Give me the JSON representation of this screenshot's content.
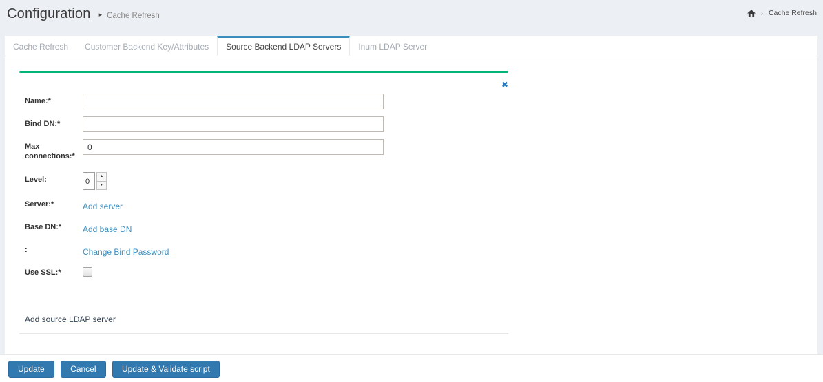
{
  "header": {
    "title": "Configuration",
    "separator_glyph": "▸",
    "section": "Cache Refresh",
    "breadcrumb": {
      "separator": "›",
      "current": "Cache Refresh"
    }
  },
  "tabs": {
    "items": [
      {
        "label": "Cache Refresh"
      },
      {
        "label": "Customer Backend Key/Attributes"
      },
      {
        "label": "Source Backend LDAP Servers"
      },
      {
        "label": "Inum LDAP Server"
      }
    ],
    "active_label": "Source Backend LDAP Servers"
  },
  "form": {
    "close_glyph": "✖",
    "name": {
      "label": "Name:*",
      "value": ""
    },
    "bind_dn": {
      "label": "Bind DN:*",
      "value": ""
    },
    "max_connections": {
      "label": "Max connections:*",
      "value": "0"
    },
    "level": {
      "label": "Level:",
      "value": "0",
      "up_glyph": "▴",
      "down_glyph": "▾"
    },
    "server": {
      "label": "Server:*",
      "link": "Add server"
    },
    "base_dn": {
      "label": "Base DN:*",
      "link": "Add base DN"
    },
    "bind_password": {
      "label": ":",
      "link": "Change Bind Password"
    },
    "use_ssl": {
      "label": "Use SSL:*",
      "checked": false
    },
    "add_source_link": "Add source LDAP server"
  },
  "footer": {
    "buttons": [
      {
        "label": "Update"
      },
      {
        "label": "Cancel"
      },
      {
        "label": "Update & Validate script"
      }
    ]
  },
  "colors": {
    "accent_green": "#00b377",
    "link_blue": "#3d8ebf",
    "tab_active_blue": "#3c8dbc",
    "button_blue": "#3179af",
    "close_x_blue": "#1e7ac4"
  }
}
